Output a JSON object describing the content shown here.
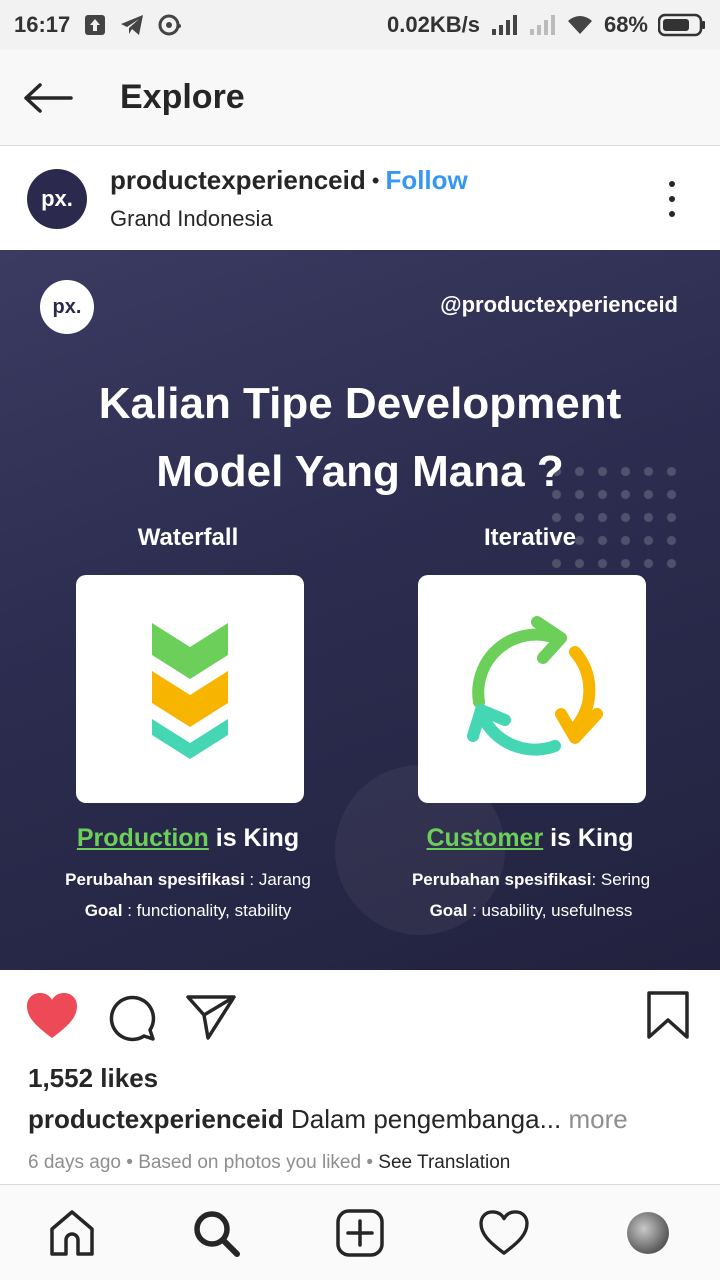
{
  "status_bar": {
    "time": "16:17",
    "net_speed": "0.02KB/s",
    "battery": "68%"
  },
  "header": {
    "title": "Explore"
  },
  "post": {
    "avatar_text": "px.",
    "username": "productexperienceid",
    "separator": "•",
    "follow_label": "Follow",
    "location": "Grand Indonesia"
  },
  "image": {
    "logo_text": "px.",
    "handle": "@productexperienceid",
    "title_line1": "Kalian Tipe Development",
    "title_line2": "Model Yang Mana ?",
    "left": {
      "heading": "Waterfall",
      "king_highlight": "Production",
      "king_rest": " is King",
      "spec_label": "Perubahan spesifikasi",
      "spec_value": " : Jarang",
      "goal_label": "Goal",
      "goal_value": " : functionality, stability"
    },
    "right": {
      "heading": "Iterative",
      "king_highlight": "Customer",
      "king_rest": " is King",
      "spec_label": "Perubahan spesifikasi",
      "spec_value": ": Sering",
      "goal_label": "Goal",
      "goal_value": " : usability, usefulness"
    }
  },
  "engagement": {
    "likes": "1,552 likes",
    "caption_user": "productexperienceid",
    "caption_text": " Dalam pengembanga...",
    "caption_more": " more",
    "time_ago": "6 days ago",
    "dot": " • ",
    "reason": "Based on photos you liked",
    "see_translation": "See Translation"
  },
  "colors": {
    "like_red": "#ed4956",
    "follow_blue": "#3897f0",
    "image_bg": "#2c2c4f",
    "green": "#6bcf5a",
    "yellow": "#f7b500",
    "teal": "#45d6b4"
  }
}
